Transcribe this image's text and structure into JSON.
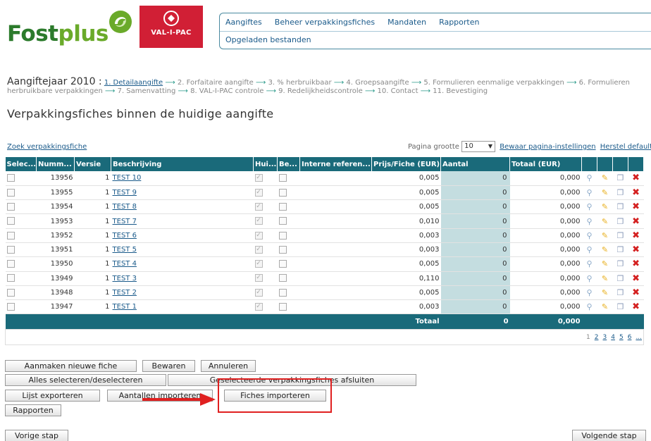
{
  "logos": {
    "fostplus_a": "Fost",
    "fostplus_b": "plus",
    "valipac": "VAL-I-PAC"
  },
  "nav": {
    "top": [
      "Aangiftes",
      "Beheer verpakkingsfiches",
      "Mandaten",
      "Rapporten"
    ],
    "sub": "Opgeladen bestanden"
  },
  "breadcrumb": {
    "year_label": "Aangiftejaar 2010 :",
    "current": "1. Detailaangifte",
    "steps": [
      "2. Forfaitaire aangifte",
      "3. % herbruikbaar",
      "4. Groepsaangifte",
      "5. Formulieren eenmalige verpakkingen",
      "6. Formulieren herbruikbare verpakkingen",
      "7. Samenvatting",
      "8. VAL-I-PAC controle",
      "9. Redelijkheidscontrole",
      "10. Contact",
      "11. Bevestiging"
    ]
  },
  "page_title": "Verpakkingsfiches binnen de huidige aangifte",
  "toolbar": {
    "search_link": "Zoek verpakkingsfiche",
    "page_size_label": "Pagina grootte",
    "page_size_value": "10",
    "save_settings": "Bewaar pagina-instellingen",
    "reset_default": "Herstel default"
  },
  "table": {
    "headers": [
      "Selec...",
      "Numm...",
      "Versie",
      "Beschrijving",
      "Hui...",
      "Be...",
      "Interne referen...",
      "Prijs/Fiche (EUR)",
      "Aantal",
      "Totaal (EUR)"
    ],
    "rows": [
      {
        "nummer": "13956",
        "versie": "1",
        "beschrijving": "TEST 10",
        "prijs": "0,005",
        "aantal": "0",
        "totaal": "0,000"
      },
      {
        "nummer": "13955",
        "versie": "1",
        "beschrijving": "TEST 9",
        "prijs": "0,005",
        "aantal": "0",
        "totaal": "0,000"
      },
      {
        "nummer": "13954",
        "versie": "1",
        "beschrijving": "TEST 8",
        "prijs": "0,005",
        "aantal": "0",
        "totaal": "0,000"
      },
      {
        "nummer": "13953",
        "versie": "1",
        "beschrijving": "TEST 7",
        "prijs": "0,010",
        "aantal": "0",
        "totaal": "0,000"
      },
      {
        "nummer": "13952",
        "versie": "1",
        "beschrijving": "TEST 6",
        "prijs": "0,003",
        "aantal": "0",
        "totaal": "0,000"
      },
      {
        "nummer": "13951",
        "versie": "1",
        "beschrijving": "TEST 5",
        "prijs": "0,003",
        "aantal": "0",
        "totaal": "0,000"
      },
      {
        "nummer": "13950",
        "versie": "1",
        "beschrijving": "TEST 4",
        "prijs": "0,005",
        "aantal": "0",
        "totaal": "0,000"
      },
      {
        "nummer": "13949",
        "versie": "1",
        "beschrijving": "TEST 3",
        "prijs": "0,110",
        "aantal": "0",
        "totaal": "0,000"
      },
      {
        "nummer": "13948",
        "versie": "1",
        "beschrijving": "TEST 2",
        "prijs": "0,005",
        "aantal": "0",
        "totaal": "0,000"
      },
      {
        "nummer": "13947",
        "versie": "1",
        "beschrijving": "TEST 1",
        "prijs": "0,003",
        "aantal": "0",
        "totaal": "0,000"
      }
    ],
    "totals": {
      "label": "Totaal",
      "aantal": "0",
      "totaal": "0,000"
    },
    "pager": [
      "1",
      "2",
      "3",
      "4",
      "5",
      "6",
      "..."
    ]
  },
  "buttons": {
    "new_fiche": "Aanmaken nieuwe fiche",
    "save": "Bewaren",
    "cancel": "Annuleren",
    "select_all": "Alles selecteren/deselecteren",
    "close_selected": "Geselecteerde verpakkingsfiches afsluiten",
    "export_list": "Lijst exporteren",
    "import_counts": "Aantallen importeren",
    "import_fiches": "Fiches importeren",
    "reports": "Rapporten",
    "prev_step": "Vorige stap",
    "next_step": "Volgende stap"
  },
  "colors": {
    "header_teal": "#1a6a7a",
    "aantal_bg": "#c4dde0",
    "highlight_red": "#e02020",
    "valipac_red": "#d11f35"
  }
}
